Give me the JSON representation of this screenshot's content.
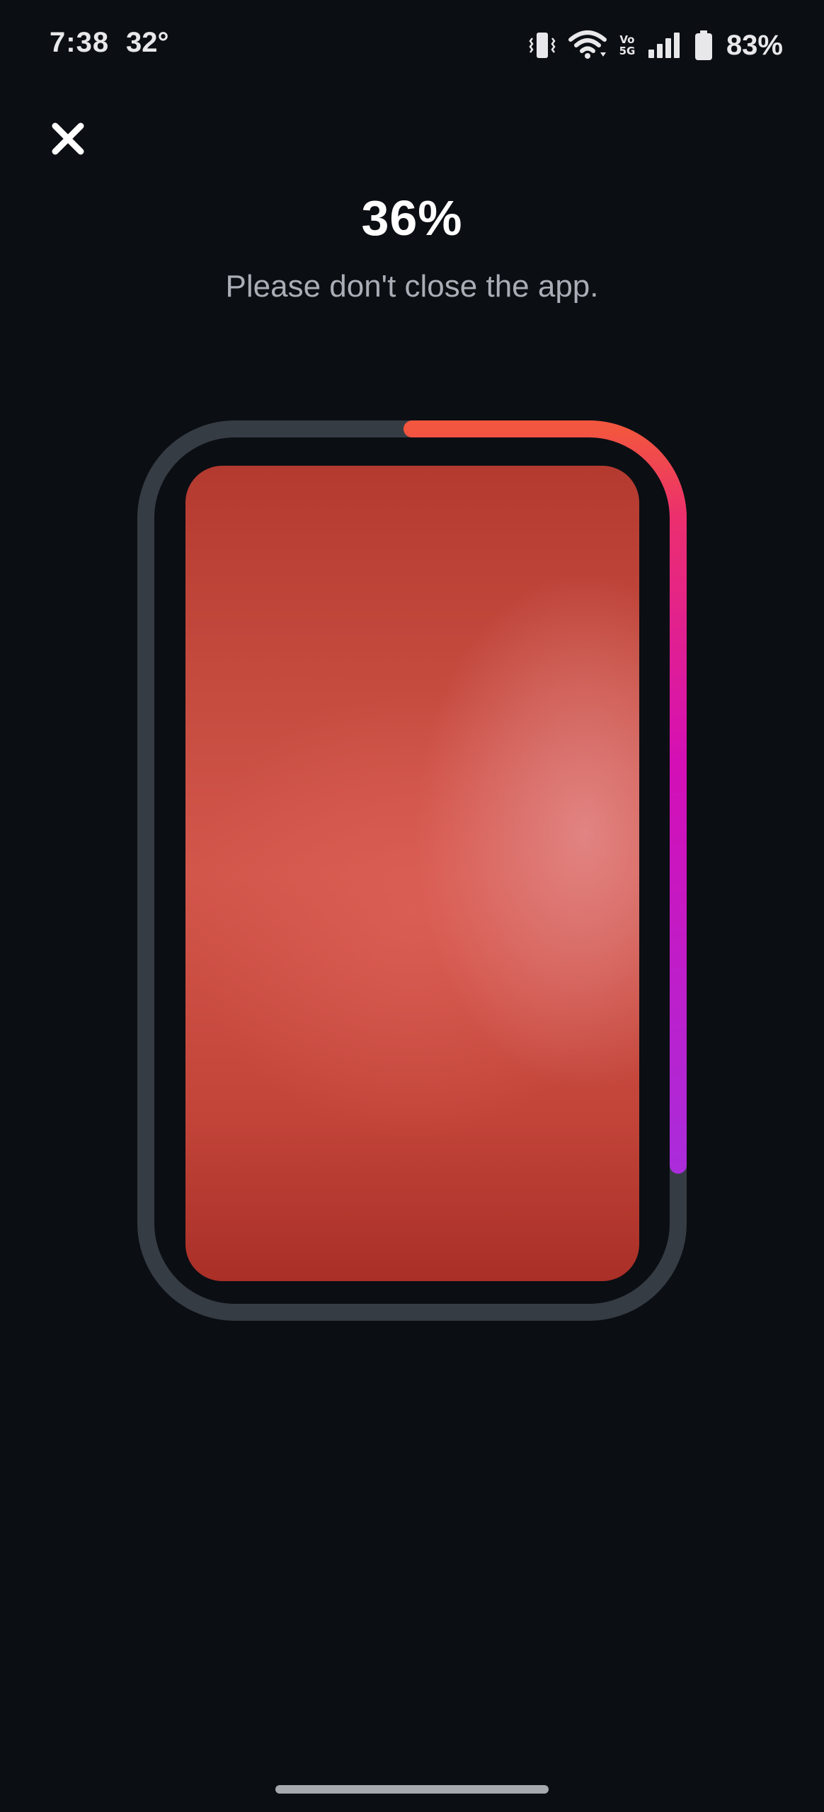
{
  "status_bar": {
    "time": "7:38",
    "temperature": "32°",
    "network": "Vo 5G",
    "battery": "83%",
    "icons": [
      "vibrate-icon",
      "wifi-icon",
      "signal-icon",
      "battery-icon"
    ]
  },
  "close_icon": "close-icon",
  "progress": {
    "percent_label": "36%",
    "percent_value": 36,
    "message": "Please don't close the app."
  },
  "colors": {
    "background": "#0b0e13",
    "frame_track": "#363c44",
    "progress_gradient": [
      "#f2563e",
      "#ec2f6e",
      "#d40fb6",
      "#9b36e8"
    ],
    "camera_tint": "#c9473c"
  }
}
